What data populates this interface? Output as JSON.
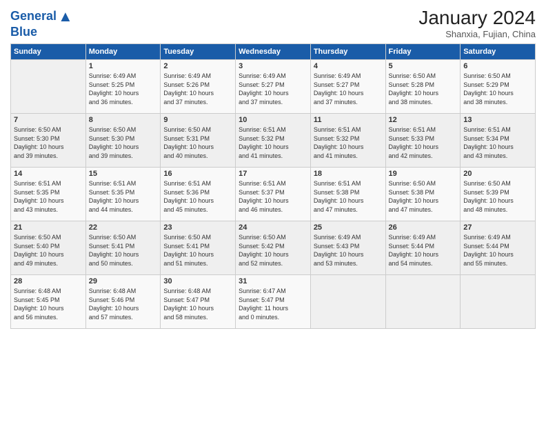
{
  "logo": {
    "line1": "General",
    "line2": "Blue"
  },
  "title": "January 2024",
  "subtitle": "Shanxia, Fujian, China",
  "headers": [
    "Sunday",
    "Monday",
    "Tuesday",
    "Wednesday",
    "Thursday",
    "Friday",
    "Saturday"
  ],
  "weeks": [
    [
      {
        "day": "",
        "info": ""
      },
      {
        "day": "1",
        "info": "Sunrise: 6:49 AM\nSunset: 5:25 PM\nDaylight: 10 hours\nand 36 minutes."
      },
      {
        "day": "2",
        "info": "Sunrise: 6:49 AM\nSunset: 5:26 PM\nDaylight: 10 hours\nand 37 minutes."
      },
      {
        "day": "3",
        "info": "Sunrise: 6:49 AM\nSunset: 5:27 PM\nDaylight: 10 hours\nand 37 minutes."
      },
      {
        "day": "4",
        "info": "Sunrise: 6:49 AM\nSunset: 5:27 PM\nDaylight: 10 hours\nand 37 minutes."
      },
      {
        "day": "5",
        "info": "Sunrise: 6:50 AM\nSunset: 5:28 PM\nDaylight: 10 hours\nand 38 minutes."
      },
      {
        "day": "6",
        "info": "Sunrise: 6:50 AM\nSunset: 5:29 PM\nDaylight: 10 hours\nand 38 minutes."
      }
    ],
    [
      {
        "day": "7",
        "info": "Sunrise: 6:50 AM\nSunset: 5:30 PM\nDaylight: 10 hours\nand 39 minutes."
      },
      {
        "day": "8",
        "info": "Sunrise: 6:50 AM\nSunset: 5:30 PM\nDaylight: 10 hours\nand 39 minutes."
      },
      {
        "day": "9",
        "info": "Sunrise: 6:50 AM\nSunset: 5:31 PM\nDaylight: 10 hours\nand 40 minutes."
      },
      {
        "day": "10",
        "info": "Sunrise: 6:51 AM\nSunset: 5:32 PM\nDaylight: 10 hours\nand 41 minutes."
      },
      {
        "day": "11",
        "info": "Sunrise: 6:51 AM\nSunset: 5:32 PM\nDaylight: 10 hours\nand 41 minutes."
      },
      {
        "day": "12",
        "info": "Sunrise: 6:51 AM\nSunset: 5:33 PM\nDaylight: 10 hours\nand 42 minutes."
      },
      {
        "day": "13",
        "info": "Sunrise: 6:51 AM\nSunset: 5:34 PM\nDaylight: 10 hours\nand 43 minutes."
      }
    ],
    [
      {
        "day": "14",
        "info": "Sunrise: 6:51 AM\nSunset: 5:35 PM\nDaylight: 10 hours\nand 43 minutes."
      },
      {
        "day": "15",
        "info": "Sunrise: 6:51 AM\nSunset: 5:35 PM\nDaylight: 10 hours\nand 44 minutes."
      },
      {
        "day": "16",
        "info": "Sunrise: 6:51 AM\nSunset: 5:36 PM\nDaylight: 10 hours\nand 45 minutes."
      },
      {
        "day": "17",
        "info": "Sunrise: 6:51 AM\nSunset: 5:37 PM\nDaylight: 10 hours\nand 46 minutes."
      },
      {
        "day": "18",
        "info": "Sunrise: 6:51 AM\nSunset: 5:38 PM\nDaylight: 10 hours\nand 47 minutes."
      },
      {
        "day": "19",
        "info": "Sunrise: 6:50 AM\nSunset: 5:38 PM\nDaylight: 10 hours\nand 47 minutes."
      },
      {
        "day": "20",
        "info": "Sunrise: 6:50 AM\nSunset: 5:39 PM\nDaylight: 10 hours\nand 48 minutes."
      }
    ],
    [
      {
        "day": "21",
        "info": "Sunrise: 6:50 AM\nSunset: 5:40 PM\nDaylight: 10 hours\nand 49 minutes."
      },
      {
        "day": "22",
        "info": "Sunrise: 6:50 AM\nSunset: 5:41 PM\nDaylight: 10 hours\nand 50 minutes."
      },
      {
        "day": "23",
        "info": "Sunrise: 6:50 AM\nSunset: 5:41 PM\nDaylight: 10 hours\nand 51 minutes."
      },
      {
        "day": "24",
        "info": "Sunrise: 6:50 AM\nSunset: 5:42 PM\nDaylight: 10 hours\nand 52 minutes."
      },
      {
        "day": "25",
        "info": "Sunrise: 6:49 AM\nSunset: 5:43 PM\nDaylight: 10 hours\nand 53 minutes."
      },
      {
        "day": "26",
        "info": "Sunrise: 6:49 AM\nSunset: 5:44 PM\nDaylight: 10 hours\nand 54 minutes."
      },
      {
        "day": "27",
        "info": "Sunrise: 6:49 AM\nSunset: 5:44 PM\nDaylight: 10 hours\nand 55 minutes."
      }
    ],
    [
      {
        "day": "28",
        "info": "Sunrise: 6:48 AM\nSunset: 5:45 PM\nDaylight: 10 hours\nand 56 minutes."
      },
      {
        "day": "29",
        "info": "Sunrise: 6:48 AM\nSunset: 5:46 PM\nDaylight: 10 hours\nand 57 minutes."
      },
      {
        "day": "30",
        "info": "Sunrise: 6:48 AM\nSunset: 5:47 PM\nDaylight: 10 hours\nand 58 minutes."
      },
      {
        "day": "31",
        "info": "Sunrise: 6:47 AM\nSunset: 5:47 PM\nDaylight: 11 hours\nand 0 minutes."
      },
      {
        "day": "",
        "info": ""
      },
      {
        "day": "",
        "info": ""
      },
      {
        "day": "",
        "info": ""
      }
    ]
  ]
}
